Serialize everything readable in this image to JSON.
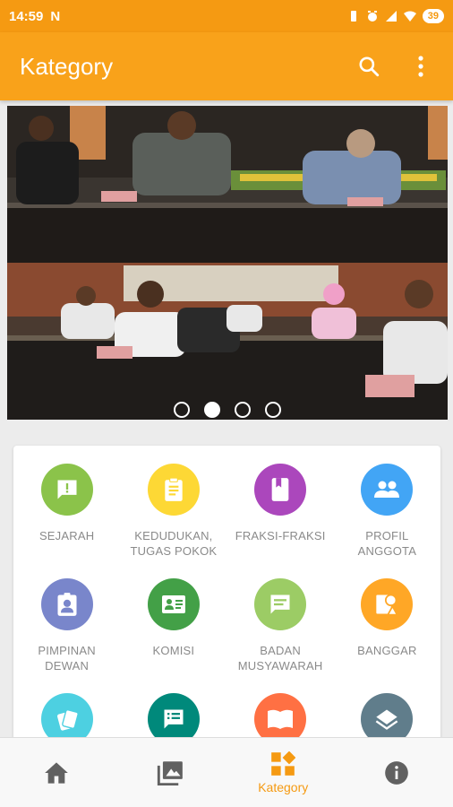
{
  "status_bar": {
    "time": "14:59",
    "notification_icon": "N",
    "battery": "39",
    "icons": [
      "vibrate-icon",
      "alarm-icon",
      "signal-icon",
      "wifi-icon"
    ]
  },
  "app_bar": {
    "title": "Kategory",
    "actions": [
      "search-icon",
      "more-vert-icon"
    ]
  },
  "banner": {
    "slide_count": 4,
    "active_slide": 2
  },
  "categories": [
    {
      "label": "SEJARAH",
      "icon": "announcement-icon",
      "color": "#8bc34a"
    },
    {
      "label": "KEDUDUKAN,\nTUGAS POKOK",
      "icon": "clipboard-icon",
      "color": "#fdd835"
    },
    {
      "label": "FRAKSI-FRAKSI",
      "icon": "book-icon",
      "color": "#ab47bc"
    },
    {
      "label": "PROFIL\nANGGOTA",
      "icon": "people-icon",
      "color": "#42a5f5"
    },
    {
      "label": "PIMPINAN\nDEWAN",
      "icon": "badge-icon",
      "color": "#7986cb"
    },
    {
      "label": "KOMISI",
      "icon": "contact-card-icon",
      "color": "#43a047"
    },
    {
      "label": "BADAN\nMUSYAWARAH",
      "icon": "chat-icon",
      "color": "#9ccc65"
    },
    {
      "label": "BANGGAR",
      "icon": "shapes-icon",
      "color": "#ffa726"
    },
    {
      "label": "",
      "icon": "cards-icon",
      "color": "#4dd0e1"
    },
    {
      "label": "",
      "icon": "comment-list-icon",
      "color": "#00897b"
    },
    {
      "label": "",
      "icon": "open-book-icon",
      "color": "#ff7043"
    },
    {
      "label": "",
      "icon": "layers-icon",
      "color": "#607d8b"
    }
  ],
  "bottom_nav": {
    "items": [
      {
        "icon": "home-icon",
        "label": ""
      },
      {
        "icon": "gallery-icon",
        "label": ""
      },
      {
        "icon": "category-icon",
        "label": "Kategory"
      },
      {
        "icon": "info-icon",
        "label": ""
      }
    ],
    "accent_color": "#f59a12"
  }
}
